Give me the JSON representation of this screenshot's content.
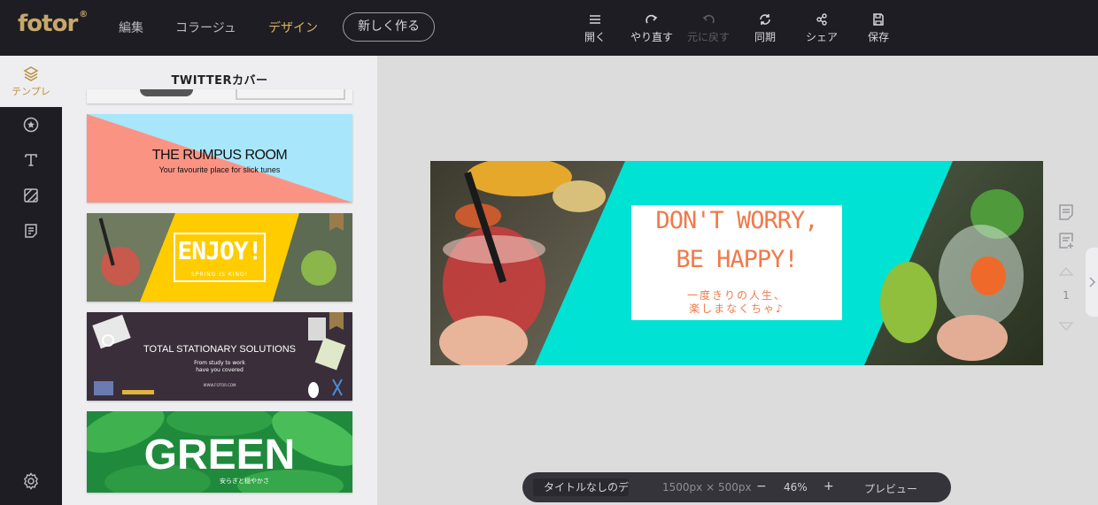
{
  "app": {
    "logo": "fotor",
    "logo_mark": "®"
  },
  "topnav": {
    "edit": "編集",
    "collage": "コラージュ",
    "design": "デザイン",
    "new": "新しく作る"
  },
  "tools": [
    {
      "label": "開く",
      "icon": "menu-icon"
    },
    {
      "label": "やり直す",
      "icon": "redo-icon"
    },
    {
      "label": "元に戻す",
      "icon": "undo-icon"
    },
    {
      "label": "同期",
      "icon": "sync-icon"
    },
    {
      "label": "シェア",
      "icon": "share-icon"
    },
    {
      "label": "保存",
      "icon": "save-icon"
    }
  ],
  "rail": {
    "templates": "テンプレ"
  },
  "panel": {
    "title": "TWITTERカバー",
    "templates": [
      {
        "title": "THE RUMPUS ROOM",
        "subtitle": "Your favourite place for slick tunes"
      },
      {
        "title": "ENJOY!",
        "subtitle": "SPRING IS KING!"
      },
      {
        "title": "TOTAL STATIONARY SOLUTIONS",
        "line1": "From study to work",
        "line2": "have you covered",
        "url": "WWW.FOTOR.COM"
      },
      {
        "title": "GREEN",
        "subtitle": "安らぎと穏やかさ"
      }
    ]
  },
  "canvas": {
    "line1": "DON'T WORRY,",
    "line2": "BE HAPPY!",
    "jp1": "一度きりの人生、",
    "jp2": "楽しまなくちゃ♪",
    "page_number": "1"
  },
  "bottombar": {
    "title_value": "タイトルなしのデザイン",
    "dimensions": "1500px × 500px",
    "minus": "−",
    "zoom": "46%",
    "plus": "+",
    "preview": "プレビュー"
  },
  "colors": {
    "accent": "#d8b45a",
    "turquoise": "#00e2d4",
    "orange": "#f07a4a",
    "yellow": "#ffcc00"
  }
}
